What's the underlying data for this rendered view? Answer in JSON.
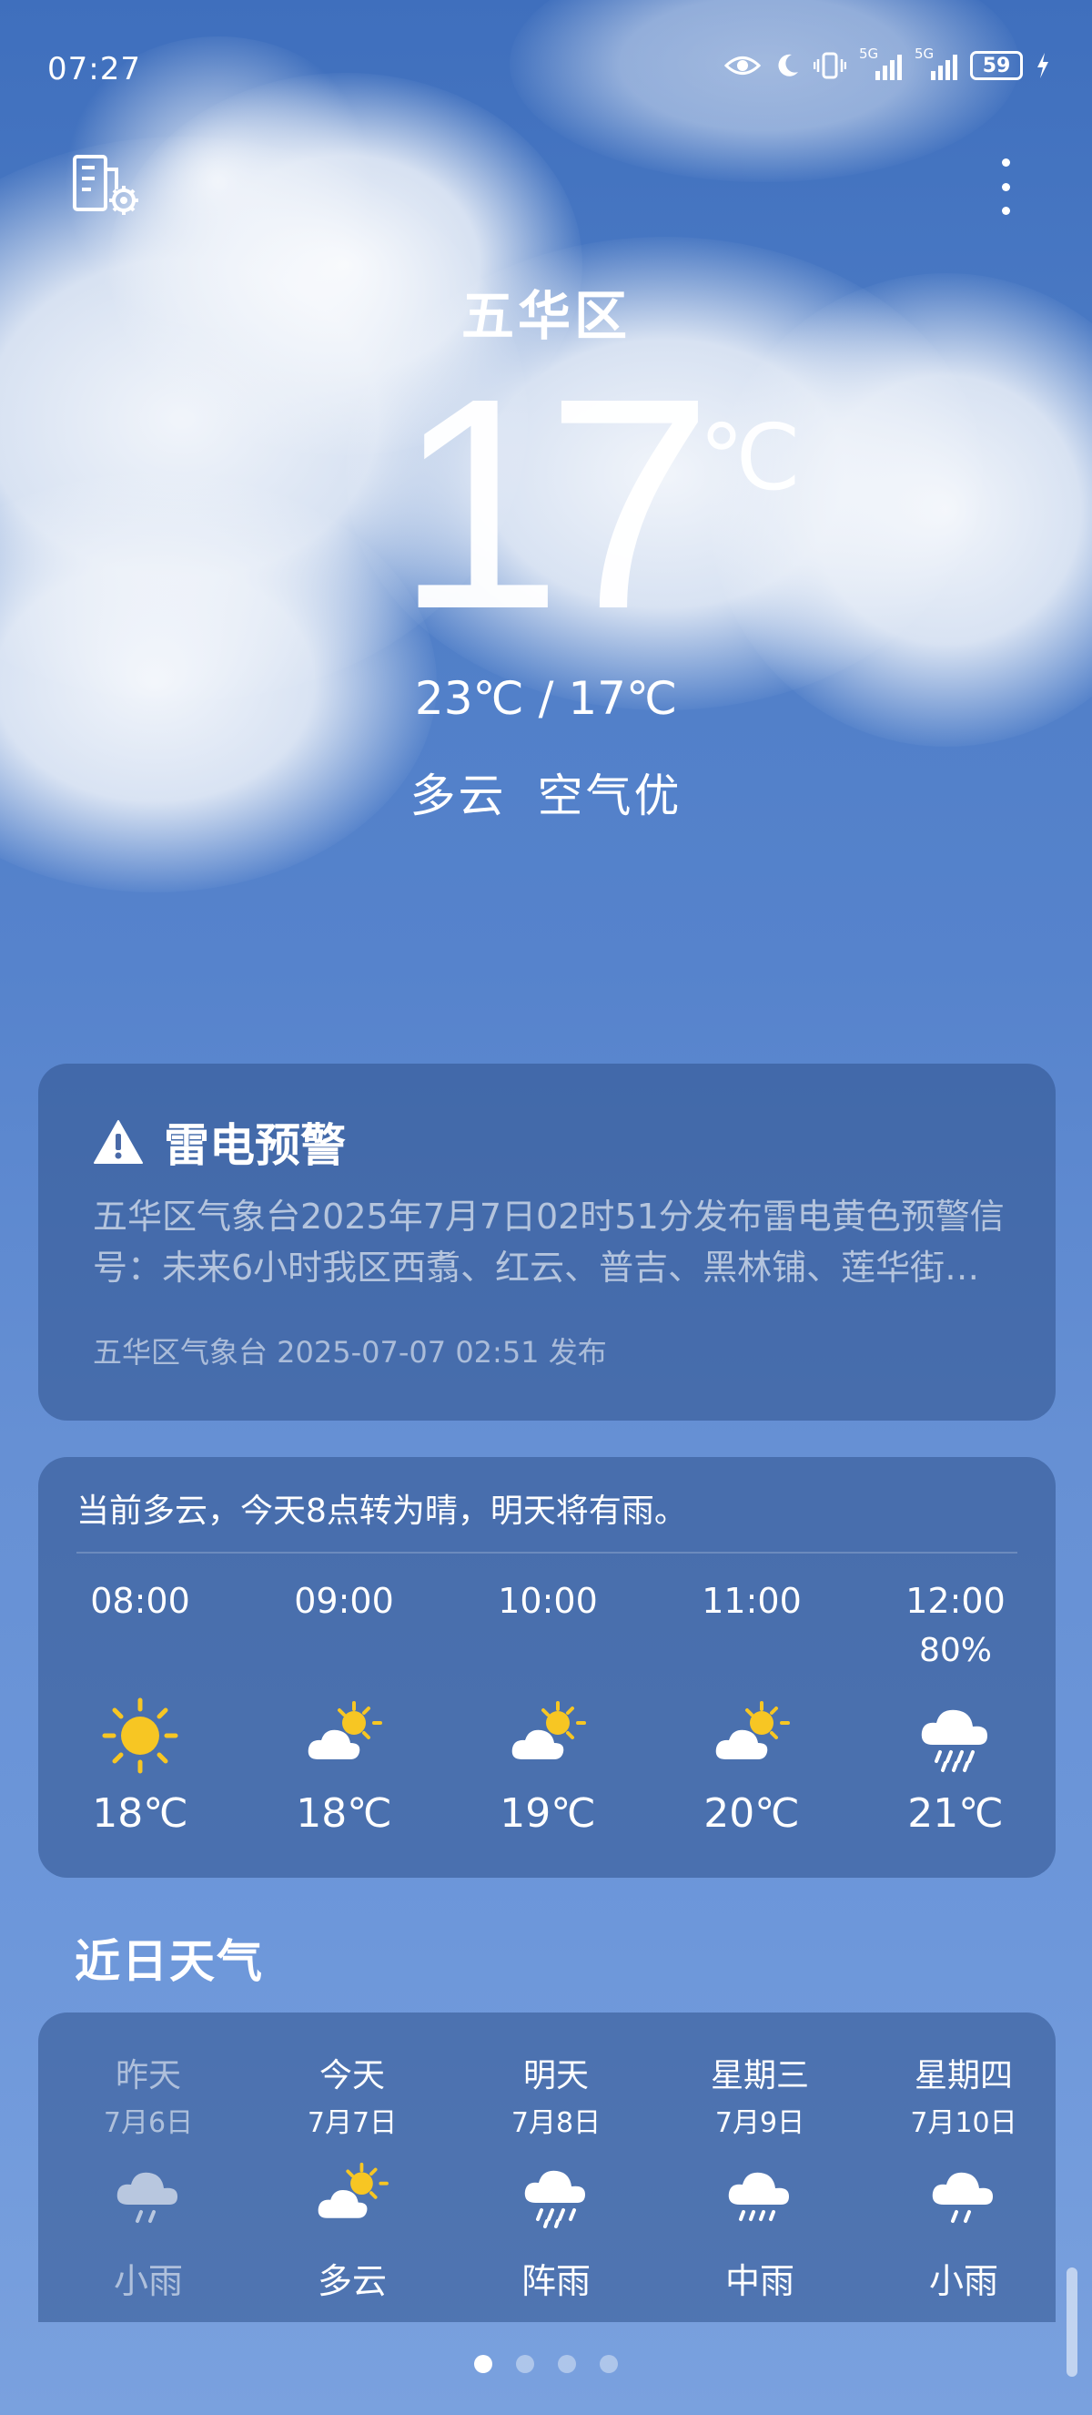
{
  "status_bar": {
    "time": "07:27",
    "network_1": "5G",
    "network_2": "5G",
    "battery": "59"
  },
  "location": {
    "district": "五华区"
  },
  "current": {
    "temperature": "17",
    "unit": "℃",
    "range": "23℃ / 17℃",
    "condition": "多云",
    "air_quality": "空气优"
  },
  "alert": {
    "title": "雷电预警",
    "body": "五华区气象台2025年7月7日02时51分发布雷电黄色预警信号：未来6小时我区西翥、红云、普吉、黑林铺、莲华街…",
    "source": "五华区气象台 2025-07-07 02:51 发布"
  },
  "hourly": {
    "summary": "当前多云，今天8点转为晴，明天将有雨。",
    "items": [
      {
        "time": "08:00",
        "precip": "",
        "icon": "sun-icon",
        "temp": "18℃"
      },
      {
        "time": "09:00",
        "precip": "",
        "icon": "partly-cloudy-icon",
        "temp": "18℃"
      },
      {
        "time": "10:00",
        "precip": "",
        "icon": "partly-cloudy-icon",
        "temp": "19℃"
      },
      {
        "time": "11:00",
        "precip": "",
        "icon": "partly-cloudy-icon",
        "temp": "20℃"
      },
      {
        "time": "12:00",
        "precip": "80%",
        "icon": "rain-icon",
        "temp": "21℃"
      }
    ]
  },
  "daily": {
    "title": "近日天气",
    "items": [
      {
        "name": "昨天",
        "date": "7月6日",
        "icon": "light-rain-icon",
        "weather": "小雨",
        "past": true
      },
      {
        "name": "今天",
        "date": "7月7日",
        "icon": "partly-cloudy-icon",
        "weather": "多云",
        "past": false
      },
      {
        "name": "明天",
        "date": "7月8日",
        "icon": "shower-icon",
        "weather": "阵雨",
        "past": false
      },
      {
        "name": "星期三",
        "date": "7月9日",
        "icon": "moderate-rain-icon",
        "weather": "中雨",
        "past": false
      },
      {
        "name": "星期四",
        "date": "7月10日",
        "icon": "light-rain-icon",
        "weather": "小雨",
        "past": false
      }
    ]
  },
  "pager": {
    "count": 4,
    "active": 1
  },
  "colors": {
    "sun": "#f7c623",
    "cloud": "#ffffff",
    "card_bg": "#30528c",
    "sky_top": "#3f6fbd",
    "sky_bottom": "#7aa1de"
  }
}
